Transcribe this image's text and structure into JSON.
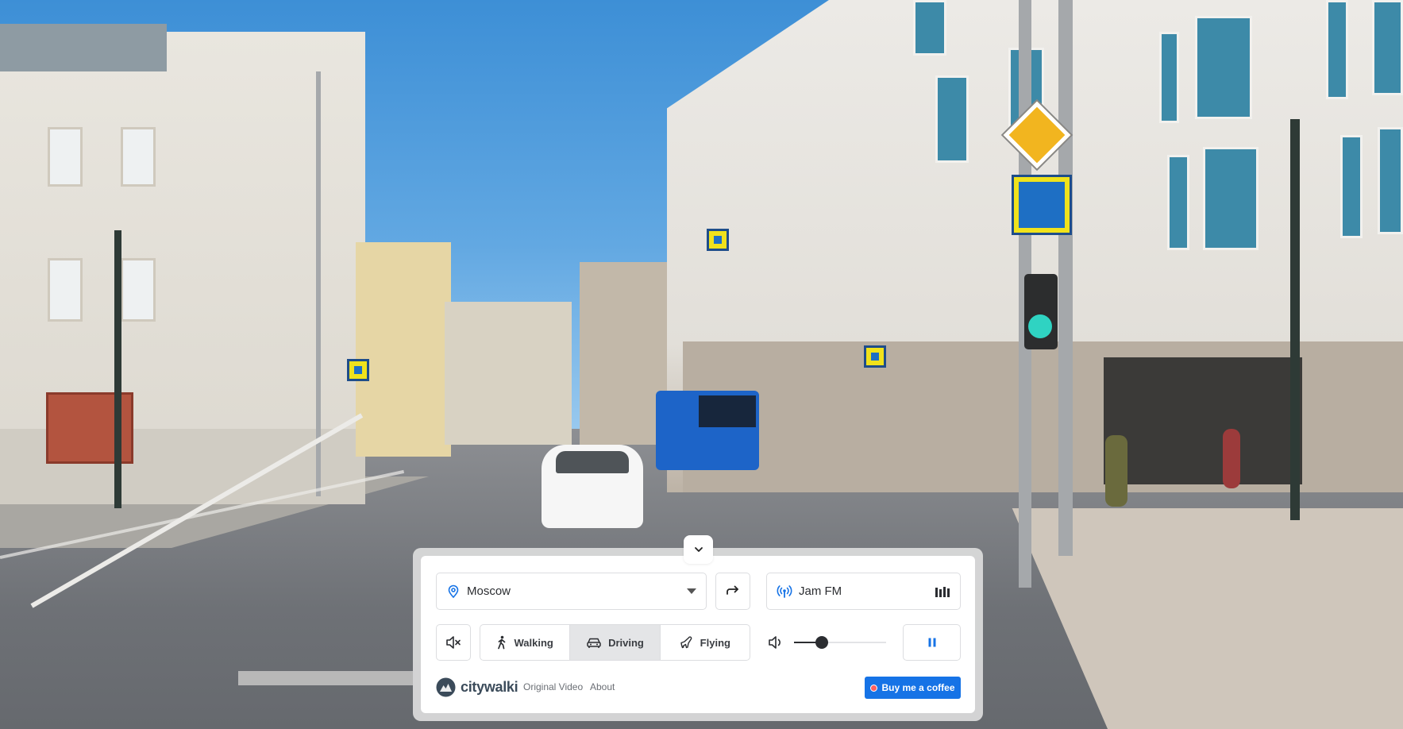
{
  "location": {
    "selected_city": "Moscow"
  },
  "radio": {
    "station": "Jam FM"
  },
  "modes": [
    {
      "label": "Walking",
      "icon": "walking-person-icon",
      "active": false
    },
    {
      "label": "Driving",
      "icon": "car-icon",
      "active": true
    },
    {
      "label": "Flying",
      "icon": "airplane-icon",
      "active": false
    }
  ],
  "audio": {
    "volume": 0.3,
    "muted": false
  },
  "footer": {
    "brand": "citywalki",
    "original_video": "Original Video",
    "about": "About",
    "coffee": "Buy me a coffee"
  },
  "colors": {
    "accent": "#1673e6",
    "radio_icon": "#1673e6",
    "active_mode_bg": "#e4e5e7"
  }
}
